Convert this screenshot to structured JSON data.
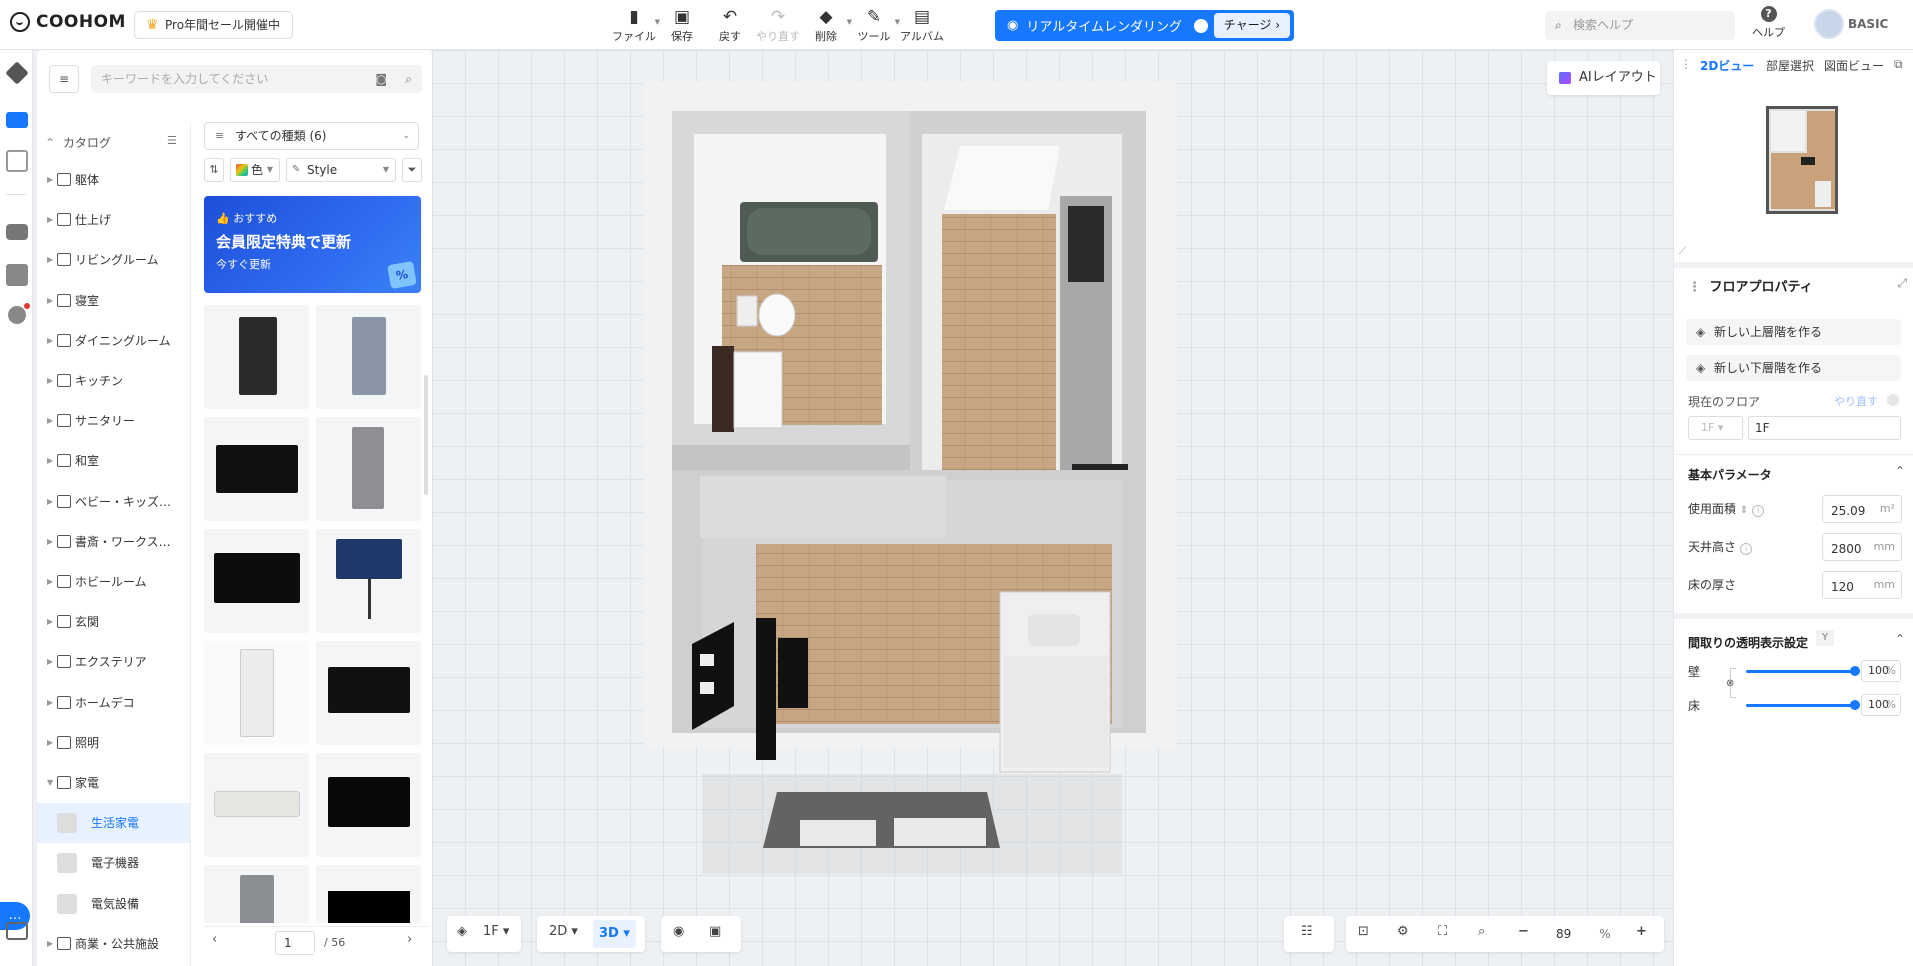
{
  "header": {
    "brand": "COOHOM",
    "promo": "Pro年間セール開催中",
    "tools": [
      {
        "label": "ファイル",
        "icon": "file-icon"
      },
      {
        "label": "保存",
        "icon": "save-icon"
      },
      {
        "label": "戻す",
        "icon": "undo-icon"
      },
      {
        "label": "やり直す",
        "icon": "redo-icon"
      },
      {
        "label": "削除",
        "icon": "eraser-icon"
      },
      {
        "label": "ツール",
        "icon": "wrench-icon"
      },
      {
        "label": "アルバム",
        "icon": "album-icon"
      }
    ],
    "render_label": "リアルタイムレンダリング",
    "charge_label": "チャージ",
    "help_search_placeholder": "検索ヘルプ",
    "help_label": "ヘルプ",
    "plan": "BASIC"
  },
  "catalog": {
    "search_placeholder": "キーワードを入力してください",
    "heading": "カタログ",
    "tree": [
      {
        "label": "躯体"
      },
      {
        "label": "仕上げ"
      },
      {
        "label": "リビングルーム"
      },
      {
        "label": "寝室"
      },
      {
        "label": "ダイニングルーム"
      },
      {
        "label": "キッチン"
      },
      {
        "label": "サニタリー"
      },
      {
        "label": "和室"
      },
      {
        "label": "ベビー・キッズ…"
      },
      {
        "label": "書斎・ワークス…"
      },
      {
        "label": "ホビールーム"
      },
      {
        "label": "玄関"
      },
      {
        "label": "エクステリア"
      },
      {
        "label": "ホームデコ"
      },
      {
        "label": "照明"
      },
      {
        "label": "家電"
      }
    ],
    "sub": [
      {
        "label": "生活家電"
      },
      {
        "label": "電子機器"
      },
      {
        "label": "電気設備"
      }
    ],
    "last": {
      "label": "商業・公共施設"
    },
    "type_select": "すべての種類 (6)",
    "color_filter": "色",
    "style_filter": "Style",
    "banner": {
      "tag": "おすすめ",
      "title": "会員限定特典で更新",
      "sub": "今すぐ更新"
    },
    "page": "1",
    "total": "/ 56"
  },
  "canvas": {
    "ai_layout": "AIレイアウト",
    "floor_select": "1F",
    "view_2d": "2D",
    "view_3d": "3D",
    "zoom": "89",
    "zoom_unit": "%"
  },
  "right": {
    "tabs": [
      "2Dビュー",
      "部屋選択",
      "図面ビュー"
    ],
    "panel_title": "フロアプロパティ",
    "new_upper": "新しい上層階を作る",
    "new_lower": "新しい下層階を作る",
    "current_floor_label": "現在のフロア",
    "redo_link": "やり直す",
    "floor_select": "1F",
    "floor_name": "1F",
    "basic_params": "基本パラメータ",
    "area_label": "使用面積",
    "area_value": "25.09",
    "area_unit": "m²",
    "ceiling_label": "天井高さ",
    "ceiling_value": "2800",
    "ceiling_unit": "mm",
    "floor_thick_label": "床の厚さ",
    "floor_thick_value": "120",
    "floor_thick_unit": "mm",
    "transparency_title": "間取りの透明表示設定",
    "transparency_badge": "Y",
    "wall_label": "壁",
    "wall_value": "100",
    "floor_label": "床",
    "floor_value": "100",
    "pct": "%"
  }
}
